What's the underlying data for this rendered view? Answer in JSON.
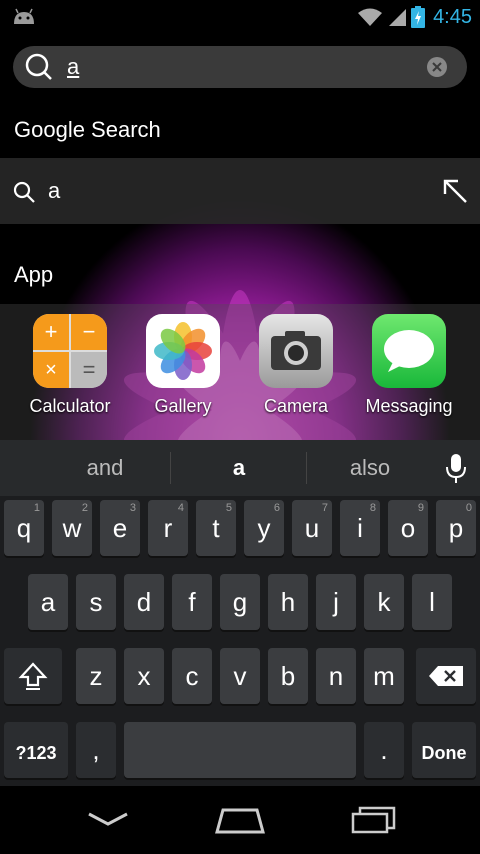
{
  "status_bar": {
    "time": "4:45"
  },
  "search": {
    "query": "a"
  },
  "google_section": {
    "title": "Google Search",
    "suggestion": "a"
  },
  "app_section": {
    "title": "App",
    "apps": [
      {
        "label": "Calculator",
        "icon": "calculator-icon"
      },
      {
        "label": "Gallery",
        "icon": "gallery-icon"
      },
      {
        "label": "Camera",
        "icon": "camera-icon"
      },
      {
        "label": "Messaging",
        "icon": "messaging-icon"
      }
    ]
  },
  "keyboard": {
    "suggestions": [
      "and",
      "a",
      "also"
    ],
    "row1": [
      {
        "key": "q",
        "hint": "1"
      },
      {
        "key": "w",
        "hint": "2"
      },
      {
        "key": "e",
        "hint": "3"
      },
      {
        "key": "r",
        "hint": "4"
      },
      {
        "key": "t",
        "hint": "5"
      },
      {
        "key": "y",
        "hint": "6"
      },
      {
        "key": "u",
        "hint": "7"
      },
      {
        "key": "i",
        "hint": "8"
      },
      {
        "key": "o",
        "hint": "9"
      },
      {
        "key": "p",
        "hint": "0"
      }
    ],
    "row2": [
      "a",
      "s",
      "d",
      "f",
      "g",
      "h",
      "j",
      "k",
      "l"
    ],
    "row3": [
      "z",
      "x",
      "c",
      "v",
      "b",
      "n",
      "m"
    ],
    "symbols_label": "?123",
    "comma": ",",
    "period": ".",
    "done_label": "Done"
  },
  "colors": {
    "time": "#33b5e5",
    "key": "#3b3d40",
    "keyboard_bg": "#1c1d1f"
  }
}
